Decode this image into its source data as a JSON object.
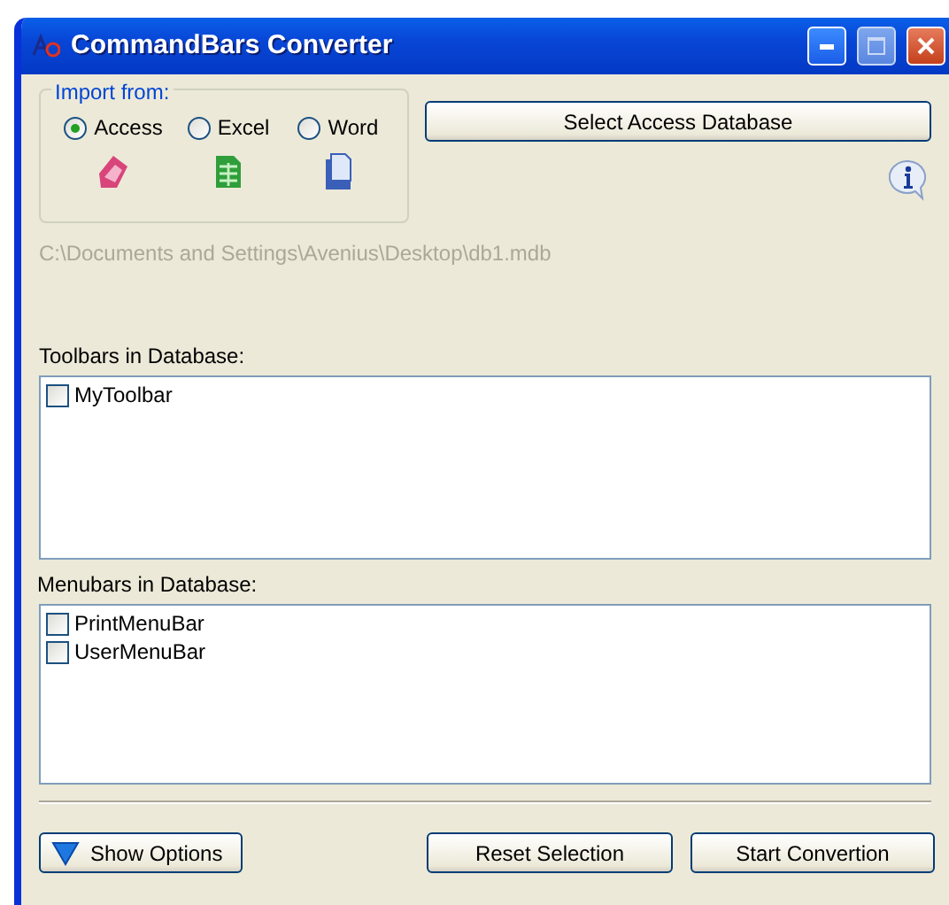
{
  "window": {
    "title": "CommandBars Converter"
  },
  "import_from": {
    "label": "Import from:",
    "options": [
      {
        "label": "Access",
        "selected": true,
        "kind": "access"
      },
      {
        "label": "Excel",
        "selected": false,
        "kind": "excel"
      },
      {
        "label": "Word",
        "selected": false,
        "kind": "word"
      }
    ]
  },
  "select_button": "Select Access Database",
  "path": "C:\\Documents and Settings\\Avenius\\Desktop\\db1.mdb",
  "toolbars": {
    "label": "Toolbars in Database:",
    "items": [
      {
        "label": "MyToolbar",
        "checked": false
      }
    ]
  },
  "menubars": {
    "label": "Menubars in Database:",
    "items": [
      {
        "label": "PrintMenuBar",
        "checked": false
      },
      {
        "label": "UserMenuBar",
        "checked": false
      }
    ]
  },
  "buttons": {
    "show_options": "Show Options",
    "reset": "Reset Selection",
    "start": "Start Convertion"
  }
}
